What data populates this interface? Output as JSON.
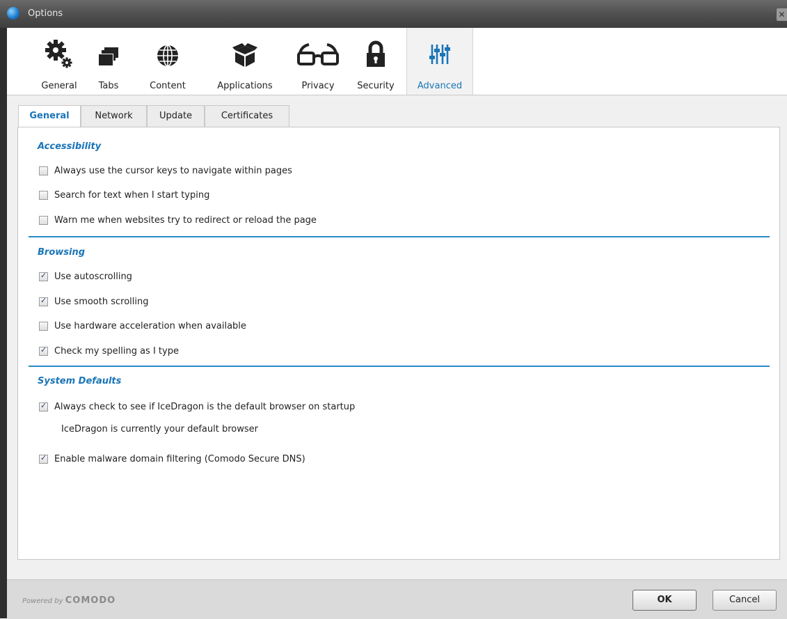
{
  "window": {
    "title": "Options"
  },
  "toolbar": {
    "items": [
      {
        "label": "General",
        "icon": "gears-icon"
      },
      {
        "label": "Tabs",
        "icon": "tabs-icon"
      },
      {
        "label": "Content",
        "icon": "globe-icon"
      },
      {
        "label": "Applications",
        "icon": "box-icon"
      },
      {
        "label": "Privacy",
        "icon": "glasses-icon"
      },
      {
        "label": "Security",
        "icon": "lock-icon"
      },
      {
        "label": "Advanced",
        "icon": "sliders-icon",
        "active": true
      }
    ]
  },
  "subtabs": [
    {
      "label": "General",
      "active": true
    },
    {
      "label": "Network"
    },
    {
      "label": "Update"
    },
    {
      "label": "Certificates"
    }
  ],
  "sections": {
    "accessibility": {
      "title": "Accessibility",
      "options": [
        {
          "label": "Always use the cursor keys to navigate within pages",
          "checked": false
        },
        {
          "label": "Search for text when I start typing",
          "checked": false
        },
        {
          "label": "Warn me when websites try to redirect or reload the page",
          "checked": false
        }
      ]
    },
    "browsing": {
      "title": "Browsing",
      "options": [
        {
          "label": "Use autoscrolling",
          "checked": true
        },
        {
          "label": "Use smooth scrolling",
          "checked": true
        },
        {
          "label": "Use hardware acceleration when available",
          "checked": false
        },
        {
          "label": "Check my spelling as I type",
          "checked": true
        }
      ]
    },
    "system_defaults": {
      "title": "System Defaults",
      "options": [
        {
          "label": "Always check to see if IceDragon is the default browser on startup",
          "checked": true
        },
        {
          "label": "Enable malware domain filtering (Comodo Secure DNS)",
          "checked": true
        }
      ],
      "status_text": "IceDragon is currently your default browser"
    }
  },
  "footer": {
    "powered_by": "Powered by",
    "brand": "COMODO",
    "ok_label": "OK",
    "cancel_label": "Cancel"
  },
  "colors": {
    "accent": "#1a75b8",
    "divider": "#2a8ac8"
  }
}
